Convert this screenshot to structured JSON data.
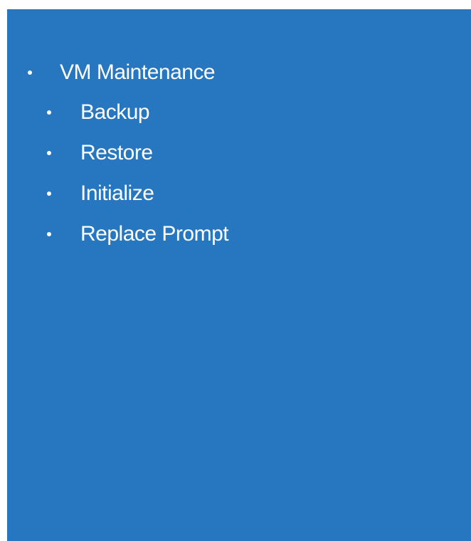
{
  "menu": {
    "title": "VM Maintenance",
    "items": [
      {
        "label": "Backup"
      },
      {
        "label": "Restore"
      },
      {
        "label": "Initialize"
      },
      {
        "label": "Replace Prompt"
      }
    ]
  },
  "colors": {
    "panel_background": "#2677bf",
    "text": "#ffffff",
    "page_background": "#ffffff"
  }
}
